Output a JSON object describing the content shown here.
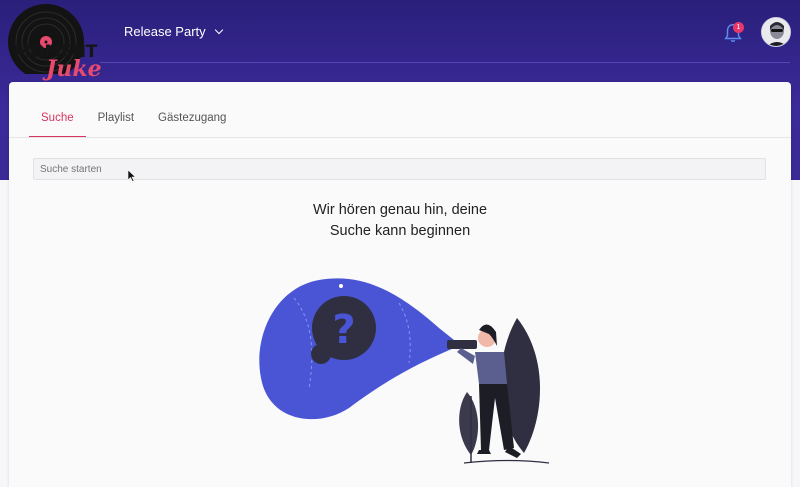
{
  "header": {
    "logo_line1": "MOMENT",
    "logo_line2": "Juke",
    "event_name": "Release Party",
    "notification_count": "1"
  },
  "tabs": [
    {
      "label": "Suche",
      "active": true
    },
    {
      "label": "Playlist",
      "active": false
    },
    {
      "label": "Gästezugang",
      "active": false
    }
  ],
  "search": {
    "placeholder": "Suche starten",
    "value": ""
  },
  "empty_state": {
    "line1": "Wir hören genau hin, deine",
    "line2": "Suche kann beginnen"
  },
  "colors": {
    "header_bg": "#3b2a9a",
    "accent": "#d8345f",
    "badge": "#e8386b",
    "illustration_blue": "#4a55d6"
  },
  "icons": [
    "vinyl-logo-icon",
    "chevron-down-icon",
    "bell-icon",
    "avatar-icon",
    "question-icon"
  ]
}
